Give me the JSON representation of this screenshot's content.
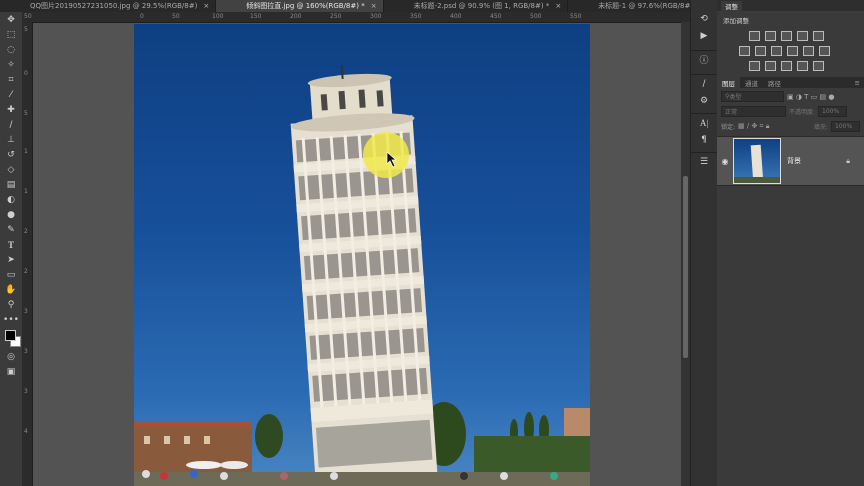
{
  "tabs": [
    {
      "label": "QQ图片20190527231050.jpg @ 29.5%(RGB/8#)",
      "active": false
    },
    {
      "label": "倾斜图拉直.jpg @ 160%(RGB/8#) *",
      "active": true
    },
    {
      "label": "未标题-2.psd @ 90.9% (图 1, RGB/8#) *",
      "active": false
    },
    {
      "label": "未标题-1 @ 97.6%(RGB/8#) *",
      "active": false
    }
  ],
  "tab_close_glyph": "×",
  "ruler_top_ticks": [
    "50",
    "0",
    "50",
    "100",
    "150",
    "200",
    "250",
    "300",
    "350",
    "400",
    "450",
    "500",
    "550"
  ],
  "ruler_left_ticks": [
    "5",
    "0",
    "5",
    "1",
    "1",
    "2",
    "2",
    "3",
    "3",
    "3",
    "4"
  ],
  "tools": [
    "move-tool",
    "marquee-tool",
    "lasso-tool",
    "magic-wand-tool",
    "crop-tool",
    "eyedropper-tool",
    "healing-brush-tool",
    "brush-tool",
    "clone-stamp-tool",
    "history-brush-tool",
    "eraser-tool",
    "gradient-tool",
    "blur-tool",
    "dodge-tool",
    "pen-tool",
    "type-tool",
    "path-selection-tool",
    "rectangle-tool",
    "hand-tool",
    "zoom-tool",
    "more-tools"
  ],
  "panel": {
    "adjust_tab": "调整",
    "add_adjust_label": "添加调整",
    "layer_tabs": [
      "图层",
      "通道",
      "路径"
    ],
    "kind_placeholder": "类型",
    "blend_mode": "正常",
    "opacity_label": "不透明度:",
    "opacity_value": "100%",
    "lock_label": "锁定:",
    "fill_label": "填充:",
    "fill_value": "100%",
    "layer_name": "背景"
  },
  "colors": {
    "sky_top": "#0e3f82",
    "cursor_highlight": "#f0e94a",
    "ui_dark": "#282828"
  }
}
